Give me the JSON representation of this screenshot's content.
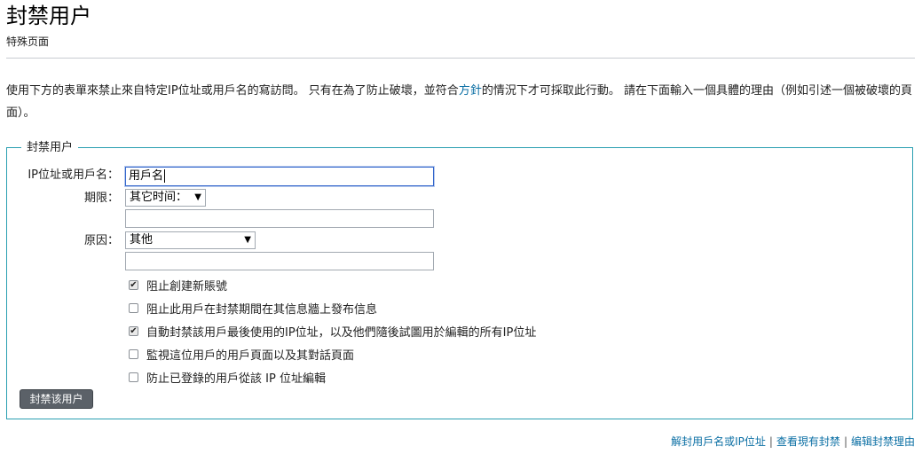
{
  "header": {
    "title": "封禁用户",
    "subtitle": "特殊页面"
  },
  "intro": {
    "text_before": "使用下方的表單來禁止來自特定IP位址或用戶名的寫訪問。 只有在為了防止破壞，並符合",
    "policy_link": "方針",
    "text_after": "的情況下才可採取此行動。 請在下面輸入一個具體的理由（例如引述一個被破壞的頁面）。"
  },
  "form": {
    "legend": "封禁用户",
    "target_label": "IP位址或用戶名：",
    "target_value": "用戶名",
    "expiry_label": "期限：",
    "expiry_selected": "其它时间：",
    "reason_label": "原因：",
    "reason_selected": "其他",
    "options": [
      {
        "label": "阻止創建新賬號",
        "checked": true
      },
      {
        "label": "阻止此用戶在封禁期間在其信息牆上發布信息",
        "checked": false
      },
      {
        "label": "自動封禁該用戶最後使用的IP位址，以及他們隨後試圖用於編輯的所有IP位址",
        "checked": true
      },
      {
        "label": "監視這位用戶的用戶頁面以及其對話頁面",
        "checked": false
      },
      {
        "label": "防止已登錄的用戶從該 IP 位址編輯",
        "checked": false
      }
    ],
    "submit_label": "封禁该用户"
  },
  "footer": {
    "link_unblock": "解封用戶名或IP位址",
    "link_view_blocks": "查看現有封禁",
    "link_edit_reasons": "编辑封禁理由",
    "separator": "|"
  },
  "colors": {
    "link": "#0b6fa4",
    "fieldset_border": "#2a9fb1",
    "button_bg": "#5b6168"
  }
}
